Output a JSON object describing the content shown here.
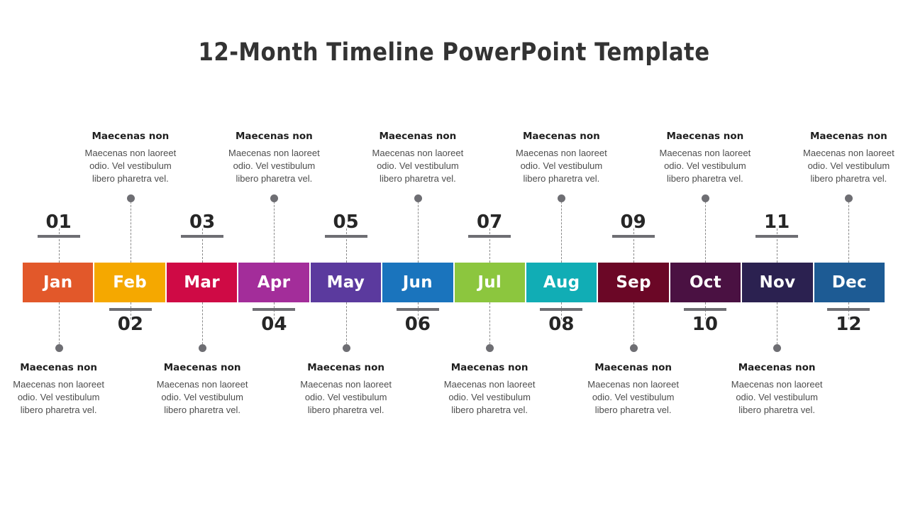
{
  "slide": {
    "title": "12-Month Timeline PowerPoint Template",
    "background_color": "#ffffff",
    "accent_line_color": "#6e6e73"
  },
  "timeline": {
    "months": [
      {
        "label": "Jan",
        "color": "#E2582A",
        "number": "01",
        "number_position": "above",
        "text_position": "below"
      },
      {
        "label": "Feb",
        "color": "#F5A800",
        "number": "02",
        "number_position": "below",
        "text_position": "above"
      },
      {
        "label": "Mar",
        "color": "#CF0A45",
        "number": "03",
        "number_position": "above",
        "text_position": "below"
      },
      {
        "label": "Apr",
        "color": "#A32D9A",
        "number": "04",
        "number_position": "below",
        "text_position": "above"
      },
      {
        "label": "May",
        "color": "#5B3A9E",
        "number": "05",
        "number_position": "above",
        "text_position": "below"
      },
      {
        "label": "Jun",
        "color": "#1A74BD",
        "number": "06",
        "number_position": "below",
        "text_position": "above"
      },
      {
        "label": "Jul",
        "color": "#8CC63E",
        "number": "07",
        "number_position": "above",
        "text_position": "below"
      },
      {
        "label": "Aug",
        "color": "#11ADB5",
        "number": "08",
        "number_position": "below",
        "text_position": "above"
      },
      {
        "label": "Sep",
        "color": "#6B0726",
        "number": "09",
        "number_position": "above",
        "text_position": "below"
      },
      {
        "label": "Oct",
        "color": "#4A1142",
        "number": "10",
        "number_position": "below",
        "text_position": "above"
      },
      {
        "label": "Nov",
        "color": "#2B2150",
        "number": "11",
        "number_position": "above",
        "text_position": "below"
      },
      {
        "label": "Dec",
        "color": "#1D5B94",
        "number": "12",
        "number_position": "below",
        "text_position": "above"
      }
    ]
  },
  "text_blocks_above": [
    {
      "title": "Maecenas non",
      "body": "Maecenas non laoreet odio. Vel vestibulum libero pharetra vel."
    },
    {
      "title": "Maecenas non",
      "body": "Maecenas non laoreet odio. Vel vestibulum libero pharetra vel."
    },
    {
      "title": "Maecenas non",
      "body": "Maecenas non laoreet odio. Vel vestibulum libero pharetra vel."
    },
    {
      "title": "Maecenas non",
      "body": "Maecenas non laoreet odio. Vel vestibulum libero pharetra vel."
    },
    {
      "title": "Maecenas non",
      "body": "Maecenas non laoreet odio. Vel vestibulum libero pharetra vel."
    },
    {
      "title": "Maecenas non",
      "body": "Maecenas non laoreet odio. Vel vestibulum libero pharetra vel."
    }
  ],
  "text_blocks_below": [
    {
      "title": "Maecenas non",
      "body": "Maecenas non laoreet odio. Vel vestibulum libero pharetra vel."
    },
    {
      "title": "Maecenas non",
      "body": "Maecenas non laoreet odio. Vel vestibulum libero pharetra vel."
    },
    {
      "title": "Maecenas non",
      "body": "Maecenas non laoreet odio. Vel vestibulum libero pharetra vel."
    },
    {
      "title": "Maecenas non",
      "body": "Maecenas non laoreet odio. Vel vestibulum libero pharetra vel."
    },
    {
      "title": "Maecenas non",
      "body": "Maecenas non laoreet odio. Vel vestibulum libero pharetra vel."
    },
    {
      "title": "Maecenas non",
      "body": "Maecenas non laoreet odio. Vel vestibulum libero pharetra vel."
    }
  ]
}
